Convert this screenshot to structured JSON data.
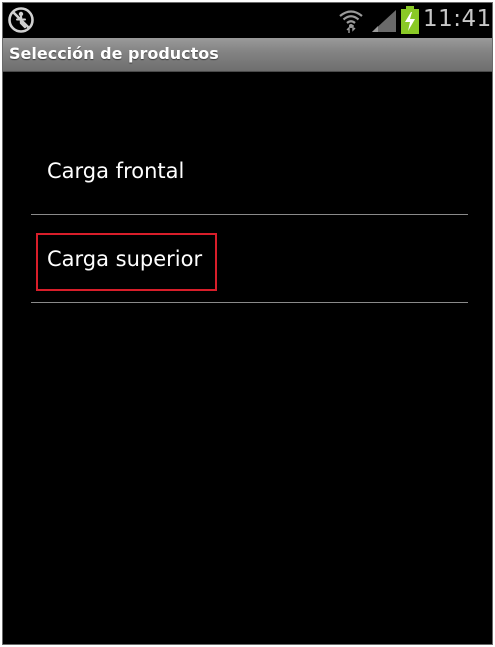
{
  "status_bar": {
    "time": "11:41",
    "icons": [
      "no-accessibility-icon",
      "wifi-icon",
      "signal-icon",
      "battery-charging-icon"
    ],
    "battery_color": "#8ac926"
  },
  "title_bar": {
    "title": "Selección de productos"
  },
  "products": {
    "items": [
      {
        "label": "Carga frontal",
        "highlighted": false
      },
      {
        "label": "Carga superior",
        "highlighted": true
      }
    ],
    "highlight_color": "#d81e2a"
  }
}
